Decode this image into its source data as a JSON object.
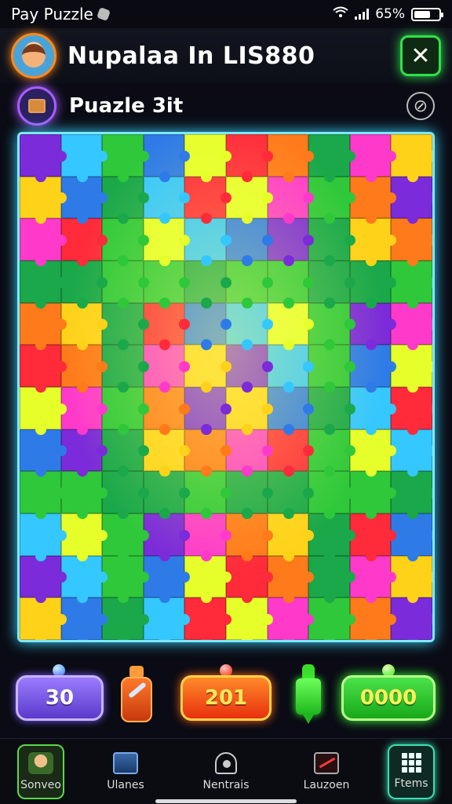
{
  "status": {
    "app_name": "Pay Puzzle",
    "battery_text": "65%",
    "icons": [
      "wifi-icon",
      "signal-icon",
      "battery-icon"
    ],
    "battery_level": 0.65
  },
  "header": {
    "title": "Nupalaa In LIS880",
    "close_label": "✕"
  },
  "subheader": {
    "title": "Puazle 3it",
    "settings_icon": "⊘"
  },
  "board": {
    "columns": 10,
    "rows": 12,
    "colors": [
      "#7b2bd9",
      "#2e7be8",
      "#ff7a1a",
      "#ffd21a",
      "#2ec83a",
      "#ff2a3a",
      "#ff3acb",
      "#35c7ff",
      "#e6ff2a",
      "#1aa84a"
    ]
  },
  "controls": {
    "purple_value": "30",
    "orange_value": "201",
    "green_value": "0000"
  },
  "nav": {
    "items": [
      {
        "label": "Sonveo",
        "icon": "avatar-icon"
      },
      {
        "label": "Ulanes",
        "icon": "map-icon"
      },
      {
        "label": "Nentrais",
        "icon": "home-icon"
      },
      {
        "label": "Lauzoen",
        "icon": "chart-icon"
      },
      {
        "label": "Ftems",
        "icon": "grid-icon"
      }
    ]
  }
}
